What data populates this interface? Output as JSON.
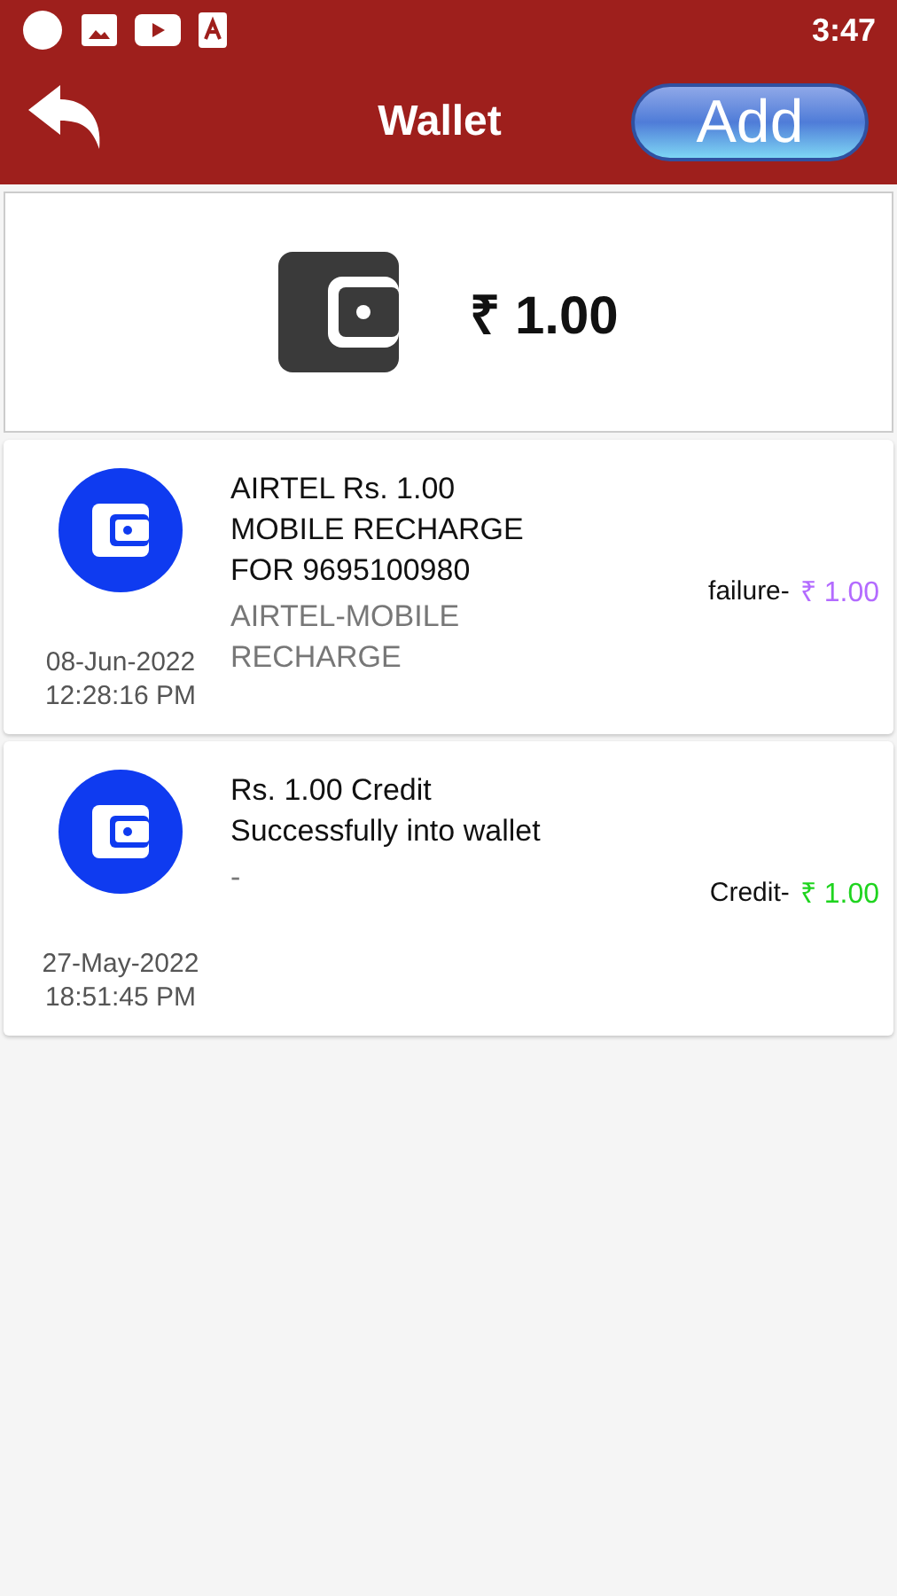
{
  "status_bar": {
    "time": "3:47"
  },
  "header": {
    "title": "Wallet",
    "add_button": "Add"
  },
  "balance": {
    "amount": "₹ 1.00"
  },
  "transactions": [
    {
      "description": "AIRTEL Rs. 1.00 MOBILE RECHARGE FOR 9695100980",
      "subtitle": "AIRTEL-MOBILE RECHARGE",
      "date": "08-Jun-2022",
      "time": "12:28:16 PM",
      "status": "failure-",
      "amount": "₹ 1.00",
      "color": "#b36bff"
    },
    {
      "description": "Rs. 1.00 Credit Successfully into wallet",
      "subtitle": "-",
      "date": "27-May-2022",
      "time": "18:51:45 PM",
      "status": "Credit-",
      "amount": "₹ 1.00",
      "color": "#1fd41f"
    }
  ]
}
